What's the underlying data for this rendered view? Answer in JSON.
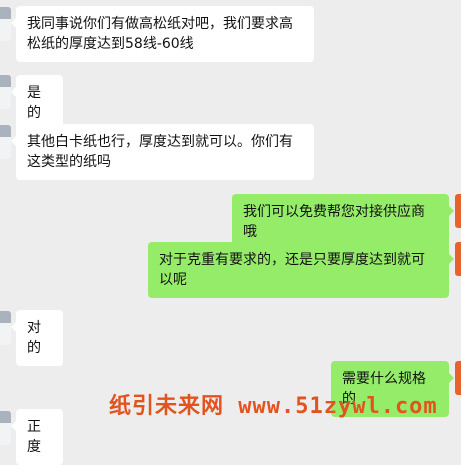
{
  "messages": [
    {
      "side": "left",
      "text": "我同事说你们有做高松纸对吧，我们要求高松纸的厚度达到58线-60线"
    },
    {
      "side": "left",
      "text": "是的"
    },
    {
      "side": "left",
      "text": "其他白卡纸也行，厚度达到就可以。你们有这类型的纸吗"
    },
    {
      "side": "right",
      "text": "我们可以免费帮您对接供应商哦"
    },
    {
      "side": "right",
      "text": "对于克重有要求的，还是只要厚度达到就可以呢"
    },
    {
      "side": "left",
      "text": "对的"
    },
    {
      "side": "right",
      "text": "需要什么规格的"
    },
    {
      "side": "left",
      "text": "正度"
    }
  ],
  "watermark": "纸引未来网 www.51zywl.com",
  "colors": {
    "background": "#ededed",
    "bubble_left": "#ffffff",
    "bubble_right": "#95ec69",
    "watermark": "#e3531f",
    "self_avatar": "#e8632b"
  }
}
